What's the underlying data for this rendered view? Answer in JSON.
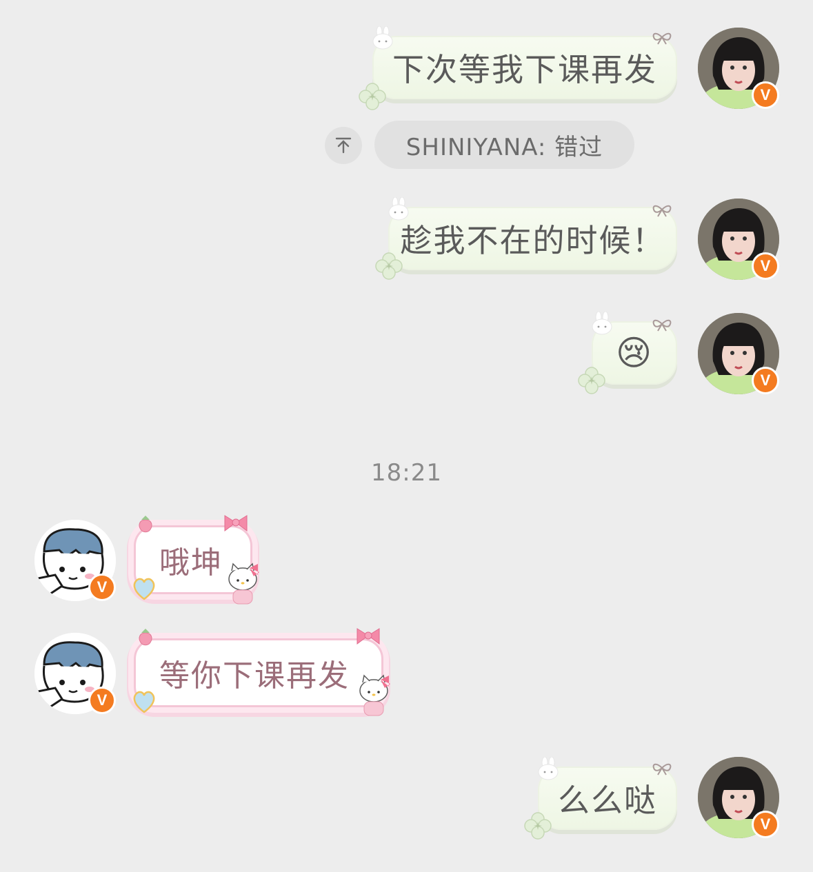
{
  "messages": [
    {
      "side": "me",
      "text": "下次等我下课再发"
    },
    {
      "side": "quote",
      "text": "SHINIYANA: 错过"
    },
    {
      "side": "me",
      "text": "趁我不在的时候！"
    },
    {
      "side": "me",
      "emoji": "😢"
    },
    {
      "side": "timestamp",
      "text": "18:21"
    },
    {
      "side": "them",
      "text": "哦坤"
    },
    {
      "side": "them",
      "text": "等你下课再发"
    },
    {
      "side": "me",
      "text": "么么哒"
    }
  ],
  "badge_letter": "V",
  "icons": {
    "quote": "arrow-to-top-icon",
    "bubble_decor": [
      "bunny-icon",
      "clover-icon",
      "ribbon-icon",
      "strawberry-icon",
      "bow-icon",
      "heart-gem-icon",
      "hello-kitty-icon"
    ]
  },
  "colors": {
    "background": "#EDEDED",
    "badge": "#F47B20",
    "me_bubble": "#F1F7E8",
    "them_bubble_border": "#F4C6D6",
    "them_text": "#9B6D79"
  }
}
